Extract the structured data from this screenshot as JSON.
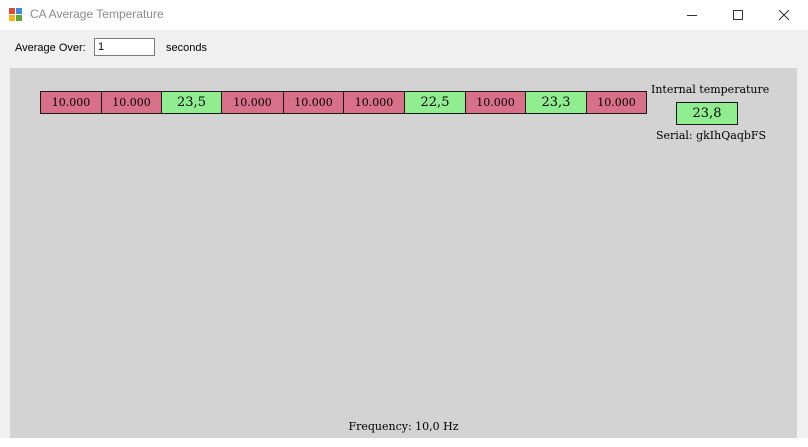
{
  "window": {
    "title": "CA Average Temperature"
  },
  "toolbar": {
    "average_label": "Average Over:",
    "average_value": "1",
    "unit_label": "seconds"
  },
  "sensors": {
    "cells": [
      {
        "value": "10.000",
        "status": "error"
      },
      {
        "value": "10.000",
        "status": "error"
      },
      {
        "value": "23,5",
        "status": "ok"
      },
      {
        "value": "10.000",
        "status": "error"
      },
      {
        "value": "10.000",
        "status": "error"
      },
      {
        "value": "10.000",
        "status": "error"
      },
      {
        "value": "22,5",
        "status": "ok"
      },
      {
        "value": "10.000",
        "status": "error"
      },
      {
        "value": "23,3",
        "status": "ok"
      },
      {
        "value": "10.000",
        "status": "error"
      }
    ]
  },
  "internal": {
    "label": "Internal temperature",
    "value": "23,8",
    "serial": "Serial: gkIhQaqbFS"
  },
  "footer": {
    "frequency": "Frequency: 10,0 Hz"
  },
  "colors": {
    "error": "#d9708a",
    "ok": "#90ee90",
    "panel": "#d3d3d3"
  }
}
